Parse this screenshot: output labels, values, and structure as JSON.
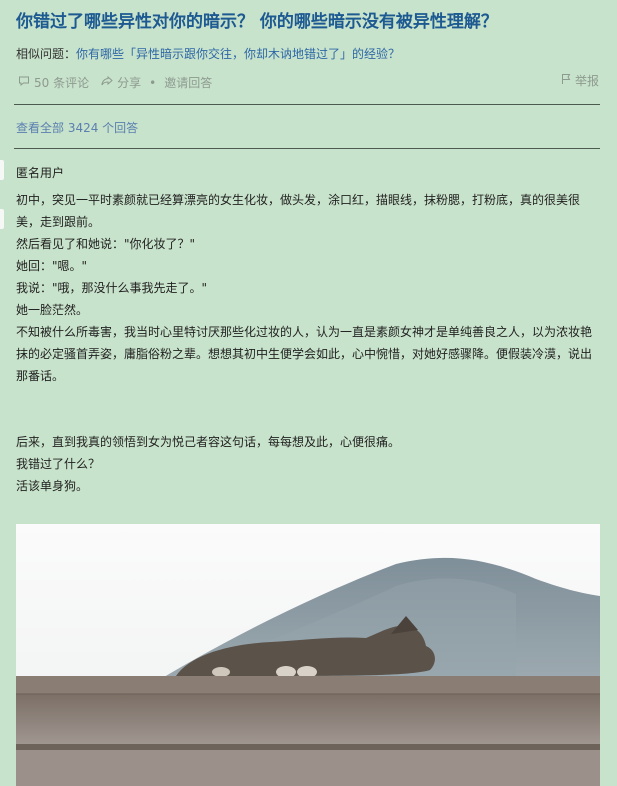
{
  "question": {
    "title": "你错过了哪些异性对你的暗示？ 你的哪些暗示没有被异性理解？",
    "similar_label": "相似问题：",
    "similar_link": "你有哪些「异性暗示跟你交往，你却木讷地错过了」的经验？"
  },
  "actions": {
    "comments": "50 条评论",
    "share": "分享",
    "separator": "•",
    "invite": "邀请回答",
    "report": "举报"
  },
  "view_all": "查看全部 3424 个回答",
  "answer": {
    "author": "匿名用户",
    "paragraphs": [
      "初中，突见一平时素颜就已经算漂亮的女生化妆，做头发，涂口红，描眼线，抹粉腮，打粉底，真的很美很美，走到跟前。",
      "然后看见了和她说：\"你化妆了？\"",
      "她回：\"嗯。\"",
      "我说：\"哦，那没什么事我先走了。\"",
      "她一脸茫然。",
      "不知被什么所毒害，我当时心里特讨厌那些化过妆的人，认为一直是素颜女神才是单纯善良之人，以为浓妆艳抹的必定骚首弄姿，庸脂俗粉之辈。想想其初中生便学会如此，心中惋惜，对她好感骤降。便假装冷漠，说出那番话。",
      "",
      "后来，直到我真的领悟到女为悦己者容这句话，每每想及此，心便很痛。",
      "我错过了什么？",
      "活该单身狗。"
    ]
  },
  "icons": {
    "comment": "comment-icon",
    "share": "share-icon",
    "report": "flag-icon"
  }
}
